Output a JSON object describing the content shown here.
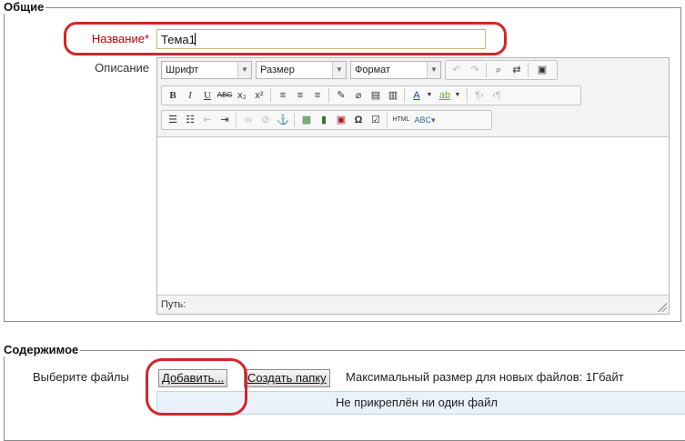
{
  "general": {
    "legend": "Общие",
    "name_label": "Название",
    "required_mark": "*",
    "name_value": "Тема1",
    "description_label": "Описание"
  },
  "editor": {
    "font_select": "Шрифт",
    "size_select": "Размер",
    "format_select": "Формат",
    "path_label": "Путь:",
    "row1_buttons": [
      "undo-icon",
      "redo-icon",
      "find-icon",
      "replace-icon",
      "fullscreen-icon"
    ],
    "row2_buttons": [
      "bold-icon",
      "italic-icon",
      "underline-icon",
      "strikethrough-icon",
      "subscript-icon",
      "superscript-icon",
      "align-left-icon",
      "align-center-icon",
      "align-right-icon",
      "clean-icon",
      "spellcheck-icon",
      "paste-text-icon",
      "paste-word-icon",
      "text-color-icon",
      "highlight-color-icon",
      "ltr-icon",
      "rtl-icon"
    ],
    "row3_buttons": [
      "bullet-list-icon",
      "numbered-list-icon",
      "outdent-icon",
      "indent-icon",
      "link-icon",
      "unlink-icon",
      "anchor-icon",
      "image-icon",
      "media-icon",
      "special-char-icon",
      "omega-icon",
      "edit-html-icon",
      "html-icon",
      "spellcheck-dropdown-icon"
    ]
  },
  "content": {
    "legend": "Содержимое",
    "choose_file_label": "Выберите файлы",
    "add_button": "Добавить...",
    "create_folder_button": "Создать папку",
    "max_size_text": "Максимальный размер для новых файлов: 1Гбайт",
    "no_files_text": "Не прикреплён ни один файл"
  },
  "colors": {
    "highlight": "#d7232a",
    "required": "#b00000"
  }
}
